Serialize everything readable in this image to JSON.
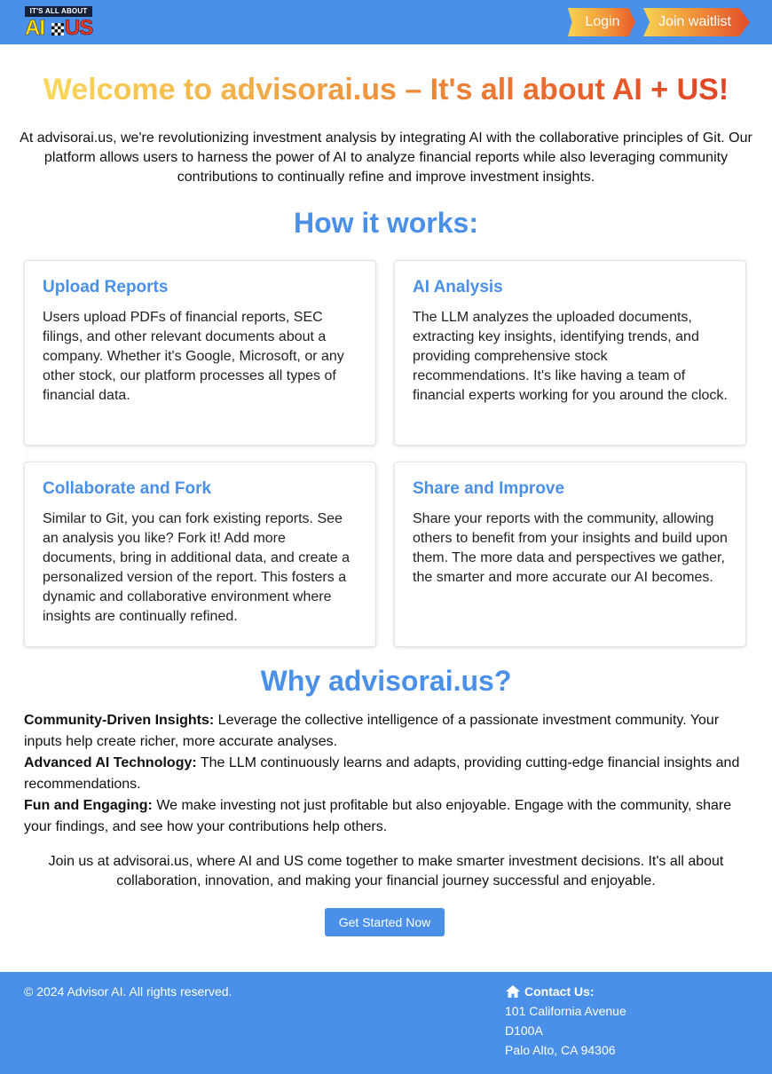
{
  "header": {
    "logo": {
      "tagline": "IT'S ALL ABOUT",
      "left": "AI",
      "right": "US"
    },
    "login_label": "Login",
    "waitlist_label": "Join waitlist"
  },
  "hero": {
    "title": "Welcome to advisorai.us – It's all about AI + US!",
    "intro": "At advisorai.us, we're revolutionizing investment analysis by integrating AI with the collaborative principles of Git. Our platform allows users to harness the power of AI to analyze financial reports while also leveraging community contributions to continually refine and improve investment insights."
  },
  "how": {
    "title": "How it works:",
    "cards": [
      {
        "title": "Upload Reports",
        "body": "Users upload PDFs of financial reports, SEC filings, and other relevant documents about a company. Whether it's Google, Microsoft, or any other stock, our platform processes all types of financial data."
      },
      {
        "title": "AI Analysis",
        "body": "The LLM analyzes the uploaded documents, extracting key insights, identifying trends, and providing comprehensive stock recommendations. It's like having a team of financial experts working for you around the clock."
      },
      {
        "title": "Collaborate and Fork",
        "body": "Similar to Git, you can fork existing reports. See an analysis you like? Fork it! Add more documents, bring in additional data, and create a personalized version of the report. This fosters a dynamic and collaborative environment where insights are continually refined."
      },
      {
        "title": "Share and Improve",
        "body": "Share your reports with the community, allowing others to benefit from your insights and build upon them. The more data and perspectives we gather, the smarter and more accurate our AI becomes."
      }
    ]
  },
  "why": {
    "title": "Why advisorai.us?",
    "items": [
      {
        "label": "Community-Driven Insights:",
        "text": " Leverage the collective intelligence of a passionate investment community. Your inputs help create richer, more accurate analyses."
      },
      {
        "label": "Advanced AI Technology:",
        "text": " The LLM continuously learns and adapts, providing cutting-edge financial insights and recommendations."
      },
      {
        "label": "Fun and Engaging:",
        "text": " We make investing not just profitable but also enjoyable. Engage with the community, share your findings, and see how your contributions help others."
      }
    ],
    "closing": "Join us at advisorai.us, where AI and US come together to make smarter investment decisions. It's all about collaboration, innovation, and making your financial journey successful and enjoyable.",
    "cta_label": "Get Started Now"
  },
  "footer": {
    "copyright": "© 2024 Advisor AI. All rights reserved.",
    "contact_heading": "Contact Us:",
    "contact_icon": "home-icon",
    "address_line1": "101 California Avenue",
    "address_line2": "D100A",
    "address_line3": "Palo Alto, CA 94306"
  },
  "colors": {
    "brand_blue": "#4a90e8",
    "gradient_start": "#fbe25a",
    "gradient_end": "#dc3a22"
  }
}
